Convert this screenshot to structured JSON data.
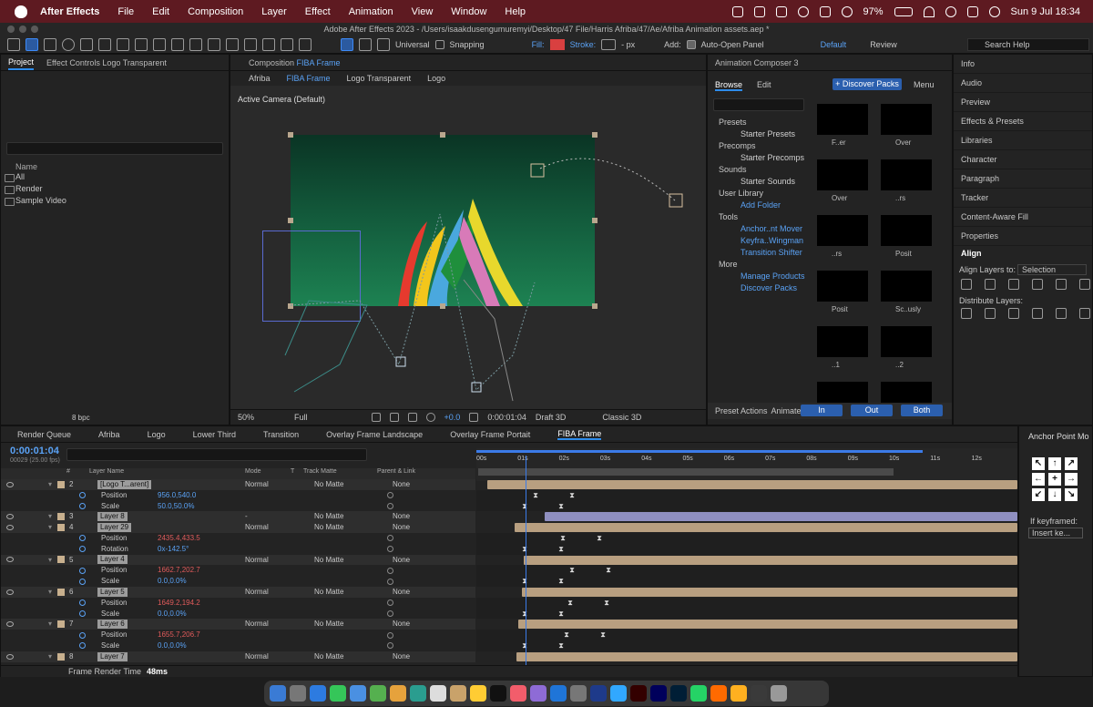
{
  "menubar": {
    "app": "After Effects",
    "items": [
      "File",
      "Edit",
      "Composition",
      "Layer",
      "Effect",
      "Animation",
      "View",
      "Window",
      "Help"
    ],
    "battery": "97%",
    "clock": "Sun 9 Jul  18:34"
  },
  "window": {
    "title": "Adobe After Effects 2023 - /Users/isaakdusengumuremyi/Desktop/47 File/Harris Afriba/47/Ae/Afriba Animation assets.aep *"
  },
  "toolbar": {
    "universal": "Universal",
    "snapping": "Snapping",
    "fill": "Fill:",
    "stroke": "Stroke:",
    "px": "- px",
    "add": "Add:",
    "auto_open": "Auto-Open Panel",
    "workspace": "Default",
    "review": "Review",
    "search": "Search Help"
  },
  "project": {
    "tabs": [
      "Project",
      "Effect Controls Logo Transparent"
    ],
    "col_name": "Name",
    "items": [
      "All",
      "Render",
      "Sample Video"
    ],
    "bpc": "8 bpc"
  },
  "composition": {
    "tab_prefix": "Composition",
    "tab_name": "FIBA Frame",
    "breadcrumbs": [
      "Afriba",
      "FIBA Frame",
      "Logo Transparent",
      "Logo"
    ],
    "camera": "Active Camera (Default)",
    "zoom": "50%",
    "quality": "Full",
    "exposure": "+0.0",
    "timecode": "0:00:01:04",
    "draft": "Draft 3D",
    "renderer": "Classic 3D"
  },
  "animcomposer": {
    "title": "Animation Composer 3",
    "tabs": [
      "Browse",
      "Edit"
    ],
    "discover": "+ Discover Packs",
    "menu": "Menu",
    "rows": [
      {
        "t": "h",
        "label": "Presets"
      },
      {
        "t": "i",
        "label": "Starter Presets"
      },
      {
        "t": "h",
        "label": "Precomps"
      },
      {
        "t": "i",
        "label": "Starter Precomps"
      },
      {
        "t": "h",
        "label": "Sounds"
      },
      {
        "t": "i",
        "label": "Starter Sounds"
      },
      {
        "t": "h",
        "label": "User Library"
      },
      {
        "t": "l",
        "label": "Add Folder"
      },
      {
        "t": "h",
        "label": "Tools"
      },
      {
        "t": "l",
        "label": "Anchor..nt Mover"
      },
      {
        "t": "l",
        "label": "Keyfra..Wingman"
      },
      {
        "t": "l",
        "label": "Transition Shifter"
      },
      {
        "t": "h",
        "label": "More"
      },
      {
        "t": "l",
        "label": "Manage Products"
      },
      {
        "t": "l",
        "label": "Discover Packs"
      }
    ],
    "thumbs": [
      "F..er",
      "Over",
      "Over",
      "..rs",
      "..rs",
      "Posit",
      "Posit",
      "Sc..usly",
      "..1",
      "..2",
      "",
      ""
    ],
    "preset_actions": "Preset Actions",
    "animate": "Animate:",
    "in": "In",
    "out": "Out",
    "both": "Both"
  },
  "rightpanel": {
    "items": [
      "Info",
      "Audio",
      "Preview",
      "Effects & Presets",
      "Libraries",
      "Character",
      "Paragraph",
      "Tracker",
      "Content-Aware Fill",
      "Properties"
    ],
    "align": "Align",
    "align_to": "Align Layers to:",
    "selection": "Selection",
    "distribute": "Distribute Layers:"
  },
  "anchor": {
    "title": "Anchor Point Mo",
    "if_kf": "If keyframed:",
    "insert": "Insert ke..."
  },
  "timeline": {
    "tabs": [
      "Render Queue",
      "Afriba",
      "Logo",
      "Lower Third",
      "Transition",
      "Overlay Frame Landscape",
      "Overlay Frame Portait",
      "FIBA Frame"
    ],
    "timecode": "0:00:01:04",
    "fps": "00029 (25.00 fps)",
    "cols": {
      "num": "#",
      "name": "Layer Name",
      "mode": "Mode",
      "t": "T",
      "matte": "Track Matte",
      "parent": "Parent & Link"
    },
    "ruler": [
      "00s",
      "01s",
      "02s",
      "03s",
      "04s",
      "05s",
      "06s",
      "07s",
      "08s",
      "09s",
      "10s",
      "11s",
      "12s"
    ],
    "rows": [
      {
        "k": "layer",
        "num": "2",
        "name": "[Logo T...arent]",
        "mode": "Normal",
        "matte": "No Matte",
        "parent": "None"
      },
      {
        "k": "prop",
        "name": "Position",
        "val": "956.0,540.0",
        "c": "blue"
      },
      {
        "k": "prop",
        "name": "Scale",
        "val": "50.0,50.0%",
        "c": "blue"
      },
      {
        "k": "layer",
        "num": "3",
        "name": "Layer 8",
        "mode": "-",
        "matte": "No Matte",
        "parent": "None"
      },
      {
        "k": "layer",
        "num": "4",
        "name": "Layer 29",
        "mode": "Normal",
        "matte": "No Matte",
        "parent": "None"
      },
      {
        "k": "prop",
        "name": "Position",
        "val": "2435.4,433.5",
        "c": "red"
      },
      {
        "k": "prop",
        "name": "Rotation",
        "val": "0x-142.5°",
        "c": "blue"
      },
      {
        "k": "layer",
        "num": "5",
        "name": "Layer 4",
        "mode": "Normal",
        "matte": "No Matte",
        "parent": "None"
      },
      {
        "k": "prop",
        "name": "Position",
        "val": "1662.7,202.7",
        "c": "red"
      },
      {
        "k": "prop",
        "name": "Scale",
        "val": "0.0,0.0%",
        "c": "blue"
      },
      {
        "k": "layer",
        "num": "6",
        "name": "Layer 5",
        "mode": "Normal",
        "matte": "No Matte",
        "parent": "None"
      },
      {
        "k": "prop",
        "name": "Position",
        "val": "1649.2,194.2",
        "c": "red"
      },
      {
        "k": "prop",
        "name": "Scale",
        "val": "0.0,0.0%",
        "c": "blue"
      },
      {
        "k": "layer",
        "num": "7",
        "name": "Layer 6",
        "mode": "Normal",
        "matte": "No Matte",
        "parent": "None"
      },
      {
        "k": "prop",
        "name": "Position",
        "val": "1655.7,206.7",
        "c": "red"
      },
      {
        "k": "prop",
        "name": "Scale",
        "val": "0.0,0.0%",
        "c": "blue"
      },
      {
        "k": "layer",
        "num": "8",
        "name": "Layer 7",
        "mode": "Normal",
        "matte": "No Matte",
        "parent": "None"
      }
    ],
    "render_time_label": "Frame Render Time",
    "render_time": "48ms"
  }
}
